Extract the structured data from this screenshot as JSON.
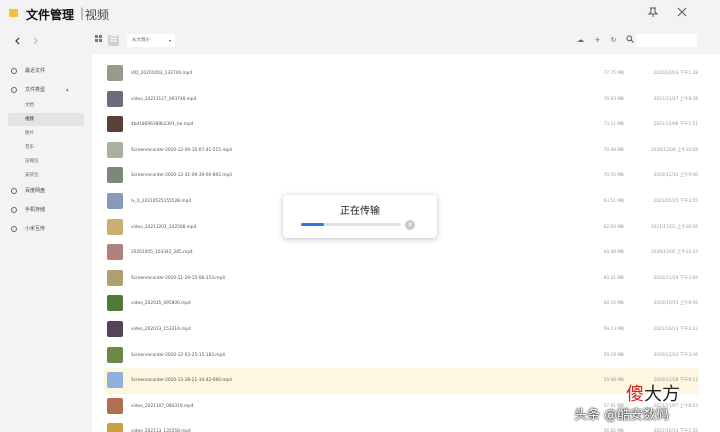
{
  "window": {
    "title": "文件管理",
    "separator": "|",
    "subtitle": "视频",
    "pin_icon": "pin-icon",
    "close_icon": "close-icon"
  },
  "sidebar": {
    "back_icon": "chevron-left-icon",
    "forward_icon": "chevron-right-icon",
    "items": [
      {
        "label": "最近文件",
        "icon": "clock-icon"
      },
      {
        "label": "文件类型",
        "icon": "folder-icon"
      },
      {
        "label": "百度网盘",
        "icon": "cloud-icon"
      },
      {
        "label": "手机存储",
        "icon": "phone-icon"
      },
      {
        "label": "小米互传",
        "icon": "transfer-icon"
      }
    ],
    "subitems": [
      {
        "label": "文档"
      },
      {
        "label": "视频",
        "active": true
      },
      {
        "label": "图片"
      },
      {
        "label": "音乐"
      },
      {
        "label": "压缩包"
      },
      {
        "label": "安装包"
      }
    ]
  },
  "toolbar": {
    "sort_label": "从大到小",
    "grid_icon": "grid-view-icon",
    "list_icon": "list-view-icon",
    "upload_icon": "upload-cloud-icon",
    "add_icon": "plus-icon",
    "refresh_icon": "refresh-icon",
    "search_icon": "search-icon",
    "search_placeholder": ""
  },
  "files": [
    {
      "name": "VID_20201003_132740.mp4",
      "size": "77.75 MB",
      "date": "2020/10/03 下午1:28",
      "thumb": "#9a9a8a"
    },
    {
      "name": "video_20211127_093748.mp4",
      "size": "76.93 MB",
      "date": "2021/11/27 上午9:38",
      "thumb": "#6f6a7d"
    },
    {
      "name": "4bd18696389b2391_tie.mp4",
      "size": "73.51 MB",
      "date": "2021/12/06 下午1:51",
      "thumb": "#5a3f3a"
    },
    {
      "name": "Screenrecorder-2020-12-09-10-07-41-515.mp4",
      "size": "70.48 MB",
      "date": "2020/12/09 上午10:08",
      "thumb": "#a8b0a0"
    },
    {
      "name": "Screenrecorder-2020-12-31-09-39-00-892.mp4",
      "size": "70.55 MB",
      "date": "2020/12/31 上午9:40",
      "thumb": "#7a8a7a"
    },
    {
      "name": "lv_0_20210525155528.mp4",
      "size": "63.51 MB",
      "date": "2021/05/25 下午3:55",
      "thumb": "#8899bb"
    },
    {
      "name": "video_20211201_102508.mp4",
      "size": "62.64 MB",
      "date": "2021/12/01 上午10:26",
      "thumb": "#c8b070"
    },
    {
      "name": "20201005_103342_285.mp4",
      "size": "60.48 MB",
      "date": "2020/10/05 上午10:33",
      "thumb": "#b08080"
    },
    {
      "name": "Screenrecorder-2020-11-29-15-08-353.mp4",
      "size": "60.41 MB",
      "date": "2020/11/29 下午3:09",
      "thumb": "#b0a070"
    },
    {
      "name": "video_202015_095800.mp4",
      "size": "60.16 MB",
      "date": "2020/10/15 上午9:59",
      "thumb": "#4f7a3a"
    },
    {
      "name": "video_202013_153214.mp4",
      "size": "59.23 MB",
      "date": "2021/10/13 下午3:32",
      "thumb": "#554455"
    },
    {
      "name": "Screenrecorder-2020-12-03-25-15-183.mp4",
      "size": "59.18 MB",
      "date": "2020/12/03 下午3:26",
      "thumb": "#6b8a4a"
    },
    {
      "name": "Screenrecorder-2020-12-28-21-10-42-690.mp4",
      "size": "59.08 MB",
      "date": "2020/12/28 下午9:11",
      "thumb": "#8fb0d8",
      "highlight": true
    },
    {
      "name": "video_2021107_080319.mp4",
      "size": "57.91 MB",
      "date": "2021/11/07 上午8:03",
      "thumb": "#b07050"
    },
    {
      "name": "video_202113_135558.mp4",
      "size": "56.62 MB",
      "date": "2021/10/13 下午1:55",
      "thumb": "#c8a040"
    }
  ],
  "modal": {
    "title": "正在传输",
    "progress": 0.23,
    "cancel_icon": "close-circle-icon"
  },
  "watermark": {
    "logo_a": "傻",
    "logo_b": "大方",
    "caption": "头条 @酷安数码"
  }
}
